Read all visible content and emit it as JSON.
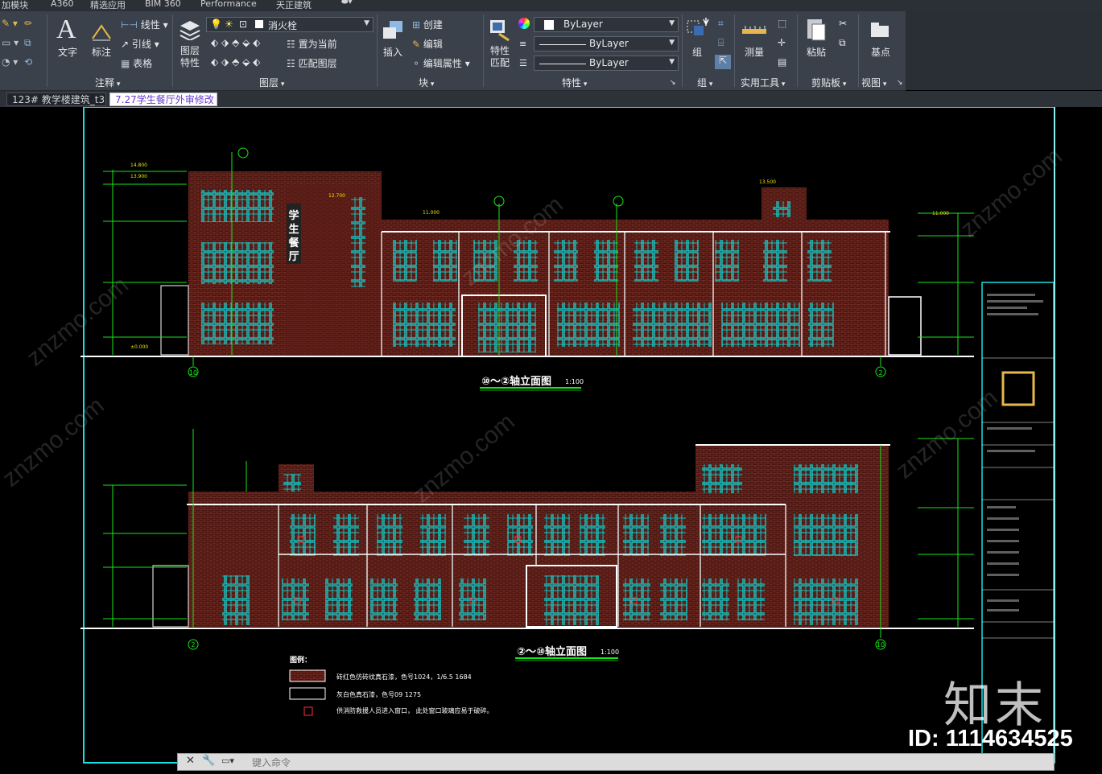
{
  "menubar": {
    "items": [
      "加模块",
      "A360",
      "精选应用",
      "BIM 360",
      "Performance",
      "天正建筑"
    ]
  },
  "ribbon": {
    "annotation": {
      "title": "注释",
      "text_label": "文字",
      "dim_label": "标注",
      "linear_label": "线性",
      "leader_label": "引线",
      "table_label": "表格"
    },
    "layers": {
      "title": "图层",
      "props_label": "图层\n特性",
      "layer_dropdown_value": "消火栓",
      "set_current_label": "置为当前",
      "match_layer_label": "匹配图层"
    },
    "block": {
      "title": "块",
      "insert_label": "插入",
      "create_label": "创建",
      "edit_label": "编辑",
      "edit_attr_label": "编辑属性"
    },
    "properties": {
      "title": "特性",
      "match_label": "特性\n匹配",
      "color_value": "ByLayer",
      "linetype_value": "ByLayer",
      "lineweight_value": "ByLayer"
    },
    "groups": {
      "title": "组",
      "group_label": "组"
    },
    "utilities": {
      "title": "实用工具",
      "measure_label": "测量"
    },
    "clipboard": {
      "title": "剪贴板",
      "paste_label": "粘贴"
    },
    "view": {
      "title": "视图",
      "base_label": "基点"
    }
  },
  "tabs": [
    {
      "label": "123# 教学楼建筑_t3",
      "active": false
    },
    {
      "label": "7.27学生餐厅外审修改",
      "active": true
    }
  ],
  "drawing": {
    "elevation1_title": "⑩～②轴立面图",
    "elevation1_scale": "1:100",
    "elevation2_title": "②～⑩轴立面图",
    "elevation2_scale": "1:100",
    "sign_text": [
      "学",
      "生",
      "餐",
      "厅"
    ],
    "legend_title": "图例：",
    "legend_items": [
      "砖红色仿砖纹真石漆，色号1024，1/6.5 1684",
      "灰白色真石漆，色号09 1275",
      "供消防救援人员进入窗口，\n此处窗口玻璃应易于破碎。"
    ],
    "axis_left_1": "10",
    "axis_right_1": "2",
    "axis_left_2": "2",
    "axis_right_2": "10",
    "level_top": "14.800",
    "level_roof": "11.000",
    "level_ground": "±0.000",
    "level_1": "13.900",
    "level_2": "12.700",
    "level_3": "13.500"
  },
  "cmdline": {
    "placeholder": "键入命令"
  },
  "watermark": {
    "logo": "知末",
    "id": "ID: 1114634525",
    "diag": "znzmo.com"
  },
  "colors": {
    "brick": "#5a1a14",
    "brick_line": "#8a3a30",
    "window": "#00e5e5",
    "axis": "#19e619",
    "frame": "#18e0e0",
    "accent_yellow": "#e6e600"
  }
}
